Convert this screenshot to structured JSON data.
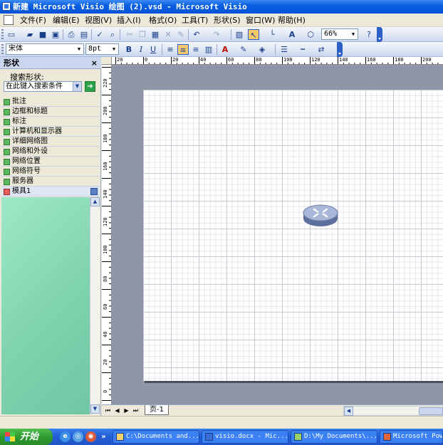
{
  "window": {
    "title": "新建 Microsoft Visio 绘图 (2).vsd - Microsoft Visio"
  },
  "menu": {
    "items": [
      {
        "label": "文件(F)"
      },
      {
        "label": "编辑(E)"
      },
      {
        "label": "视图(V)"
      },
      {
        "label": "插入(I)"
      },
      {
        "label": "格式(O)"
      },
      {
        "label": "工具(T)"
      },
      {
        "label": "形状(S)"
      },
      {
        "label": "窗口(W)"
      },
      {
        "label": "帮助(H)"
      }
    ]
  },
  "toolbar_standard": {
    "zoom": "66%"
  },
  "toolbar_format": {
    "font": "宋体",
    "font_size": "8pt",
    "bold": "B",
    "italic": "I",
    "underline": "U"
  },
  "shapes_pane": {
    "title": "形状",
    "close": "×",
    "search_label": "搜索形状:",
    "search_placeholder": "在此键入搜索条件",
    "stencils": [
      {
        "label": "批注"
      },
      {
        "label": "边框和标题"
      },
      {
        "label": "标注"
      },
      {
        "label": "计算机和显示器"
      },
      {
        "label": "详细网络图"
      },
      {
        "label": "网络和外设"
      },
      {
        "label": "网络位置"
      },
      {
        "label": "网络符号"
      },
      {
        "label": "服务器"
      },
      {
        "label": "模具1"
      }
    ]
  },
  "rulers": {
    "top": [
      "20",
      "0",
      "20",
      "40",
      "60",
      "80",
      "100",
      "120",
      "140",
      "160",
      "180",
      "200"
    ],
    "left": [
      "220",
      "200",
      "180",
      "160",
      "140",
      "120",
      "100",
      "80",
      "60",
      "40",
      "20",
      "0"
    ]
  },
  "page_tab": {
    "label": "页-1"
  },
  "taskbar": {
    "start": "开始",
    "tasks": [
      {
        "label": "C:\\Documents and..."
      },
      {
        "label": "visio.docx - Mic..."
      },
      {
        "label": "D:\\My Documents\\..."
      },
      {
        "label": "Microsoft Power"
      }
    ]
  }
}
